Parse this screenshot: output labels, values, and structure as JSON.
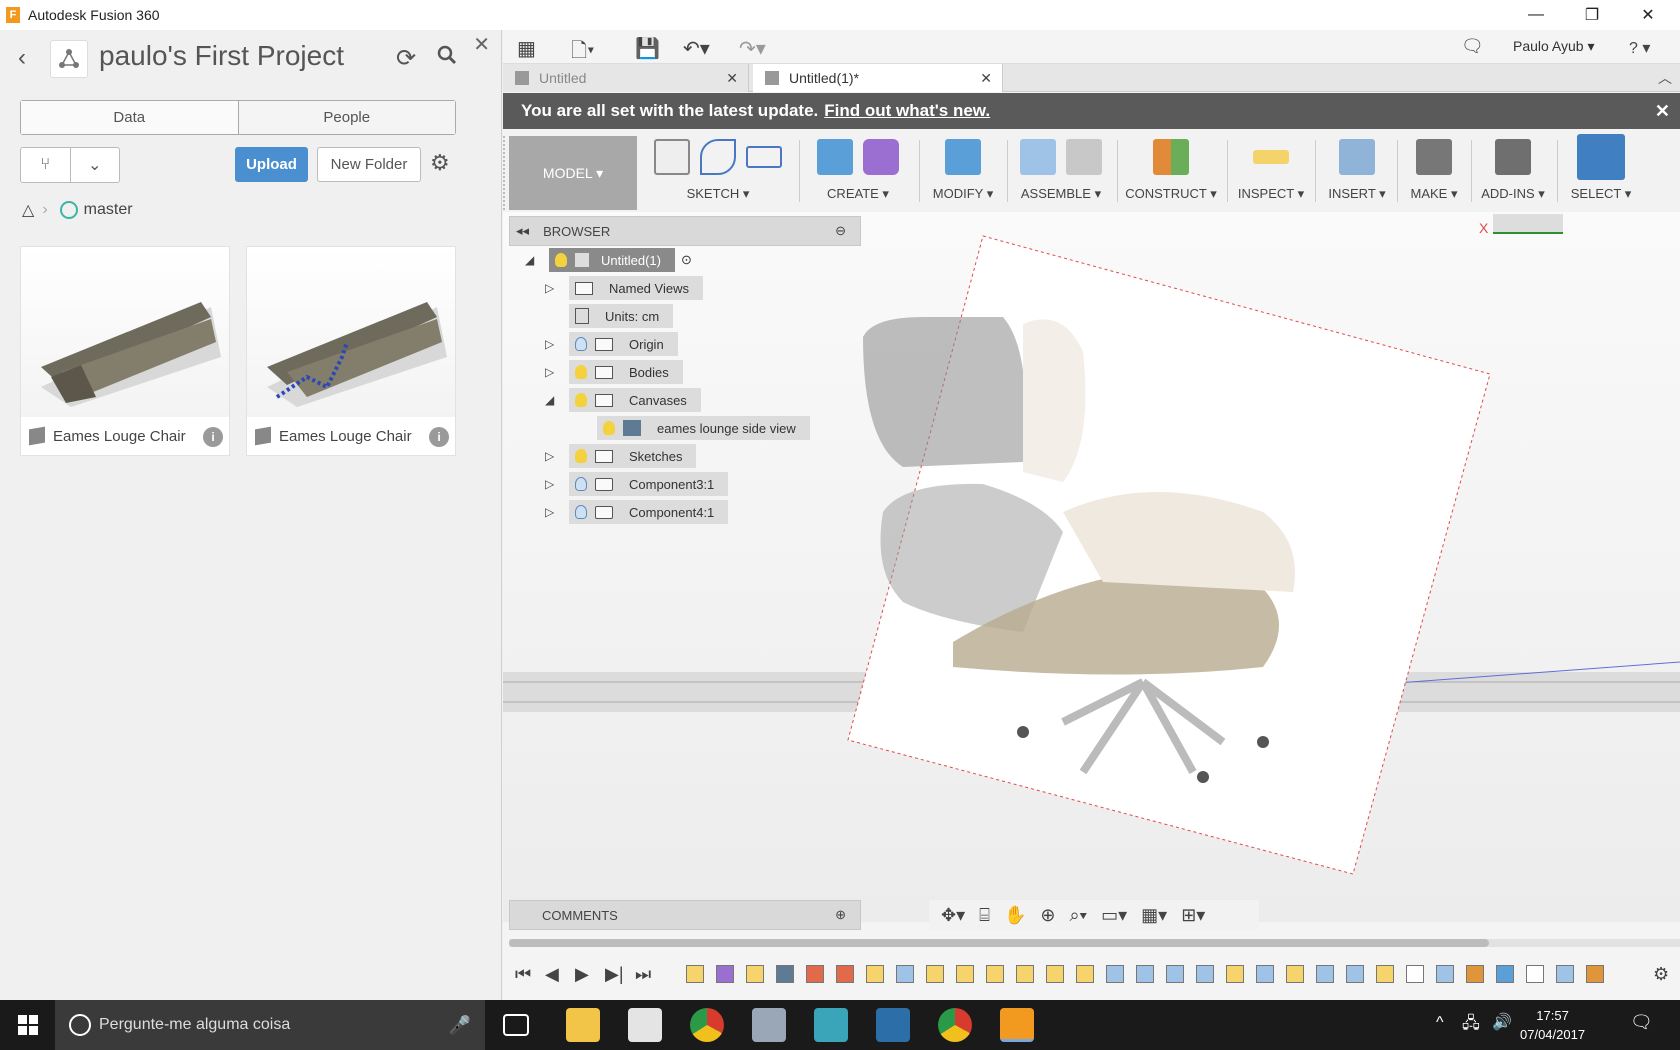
{
  "window": {
    "title": "Autodesk Fusion 360",
    "app_icon_letter": "F"
  },
  "left": {
    "project_title": "paulo's First Project",
    "segments": {
      "data": "Data",
      "people": "People"
    },
    "upload_label": "Upload",
    "new_folder_label": "New Folder",
    "branch": "master",
    "files": [
      {
        "name": "Eames Louge Chair"
      },
      {
        "name": "Eames Louge Chair"
      }
    ]
  },
  "main": {
    "user": "Paulo Ayub ▾",
    "help": "? ▾",
    "tabs": [
      {
        "label": "Untitled",
        "active": false
      },
      {
        "label": "Untitled(1)*",
        "active": true
      }
    ],
    "banner": {
      "text": "You are all set with the latest update.",
      "link": "Find out what's new."
    },
    "workspace": "MODEL ▾",
    "groups": [
      {
        "label": "SKETCH ▾"
      },
      {
        "label": "CREATE ▾"
      },
      {
        "label": "MODIFY ▾"
      },
      {
        "label": "ASSEMBLE ▾"
      },
      {
        "label": "CONSTRUCT ▾"
      },
      {
        "label": "INSPECT ▾"
      },
      {
        "label": "INSERT ▾"
      },
      {
        "label": "MAKE ▾"
      },
      {
        "label": "ADD-INS ▾"
      },
      {
        "label": "SELECT ▾"
      }
    ],
    "browser": {
      "title": "BROWSER",
      "nodes": [
        {
          "label": "Untitled(1)"
        },
        {
          "label": "Named Views"
        },
        {
          "label": "Units: cm"
        },
        {
          "label": "Origin"
        },
        {
          "label": "Bodies"
        },
        {
          "label": "Canvases"
        },
        {
          "label": "eames lounge side view"
        },
        {
          "label": "Sketches"
        },
        {
          "label": "Component3:1"
        },
        {
          "label": "Component4:1"
        }
      ]
    },
    "comments_title": "COMMENTS",
    "axis_label": "X"
  },
  "taskbar": {
    "search_placeholder": "Pergunte-me alguma coisa",
    "time": "17:57",
    "date": "07/04/2017"
  },
  "colors": {
    "accent": "#4a8fcf",
    "banner": "#5a5a5a",
    "taskbar": "#1a1a1a"
  }
}
